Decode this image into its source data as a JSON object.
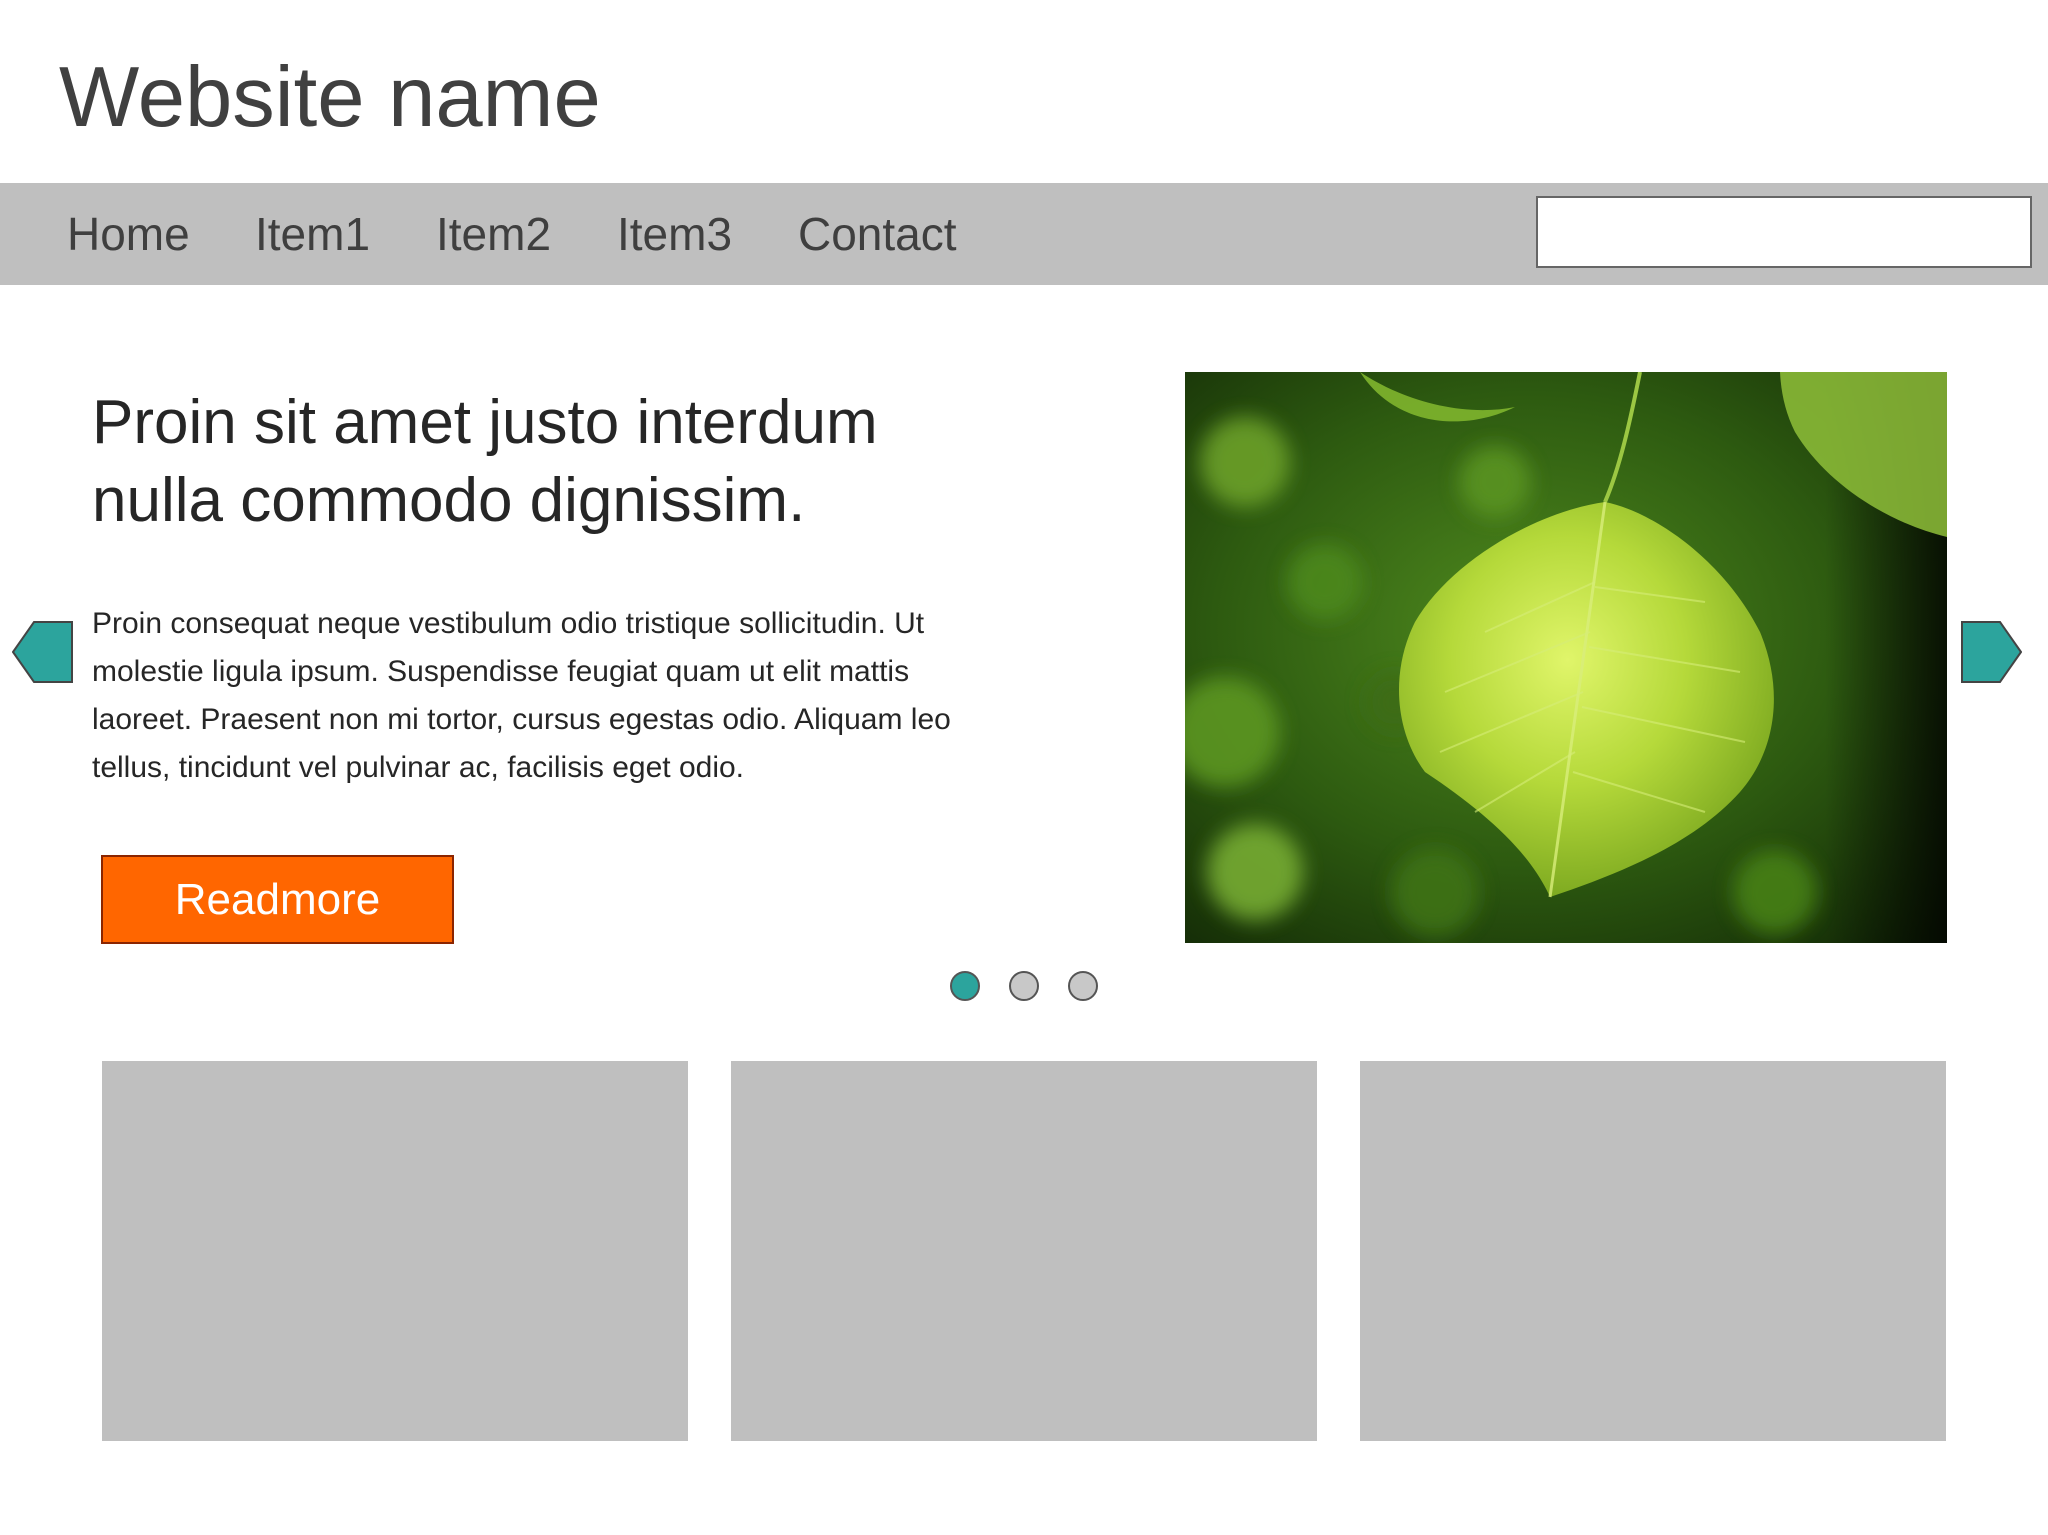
{
  "header": {
    "site_name": "Website name"
  },
  "nav": {
    "items": [
      {
        "label": "Home"
      },
      {
        "label": "Item1"
      },
      {
        "label": "Item2"
      },
      {
        "label": "Item3"
      },
      {
        "label": "Contact"
      }
    ],
    "search": {
      "value": "",
      "placeholder": ""
    }
  },
  "slider": {
    "heading": "Proin sit amet justo interdum nulla commodo dignissim.",
    "body": "Proin consequat neque vestibulum odio tristique sollicitudin. Ut molestie ligula ipsum. Suspendisse feugiat quam ut elit mattis laoreet. Praesent non mi tortor, cursus egestas odio. Aliquam leo tellus, tincidunt vel pulvinar ac, facilisis eget odio.",
    "button_label": "Readmore",
    "image_icon": "leaf-photo",
    "prev_icon": "arrow-left-icon",
    "next_icon": "arrow-right-icon",
    "slide_count": 3,
    "active_slide": 1
  },
  "cards": {
    "count": 3
  },
  "colors": {
    "nav_background": "#bfbfbf",
    "accent_teal": "#2ca49d",
    "button_orange": "#ff6600",
    "placeholder_gray": "#bfbfbf"
  }
}
